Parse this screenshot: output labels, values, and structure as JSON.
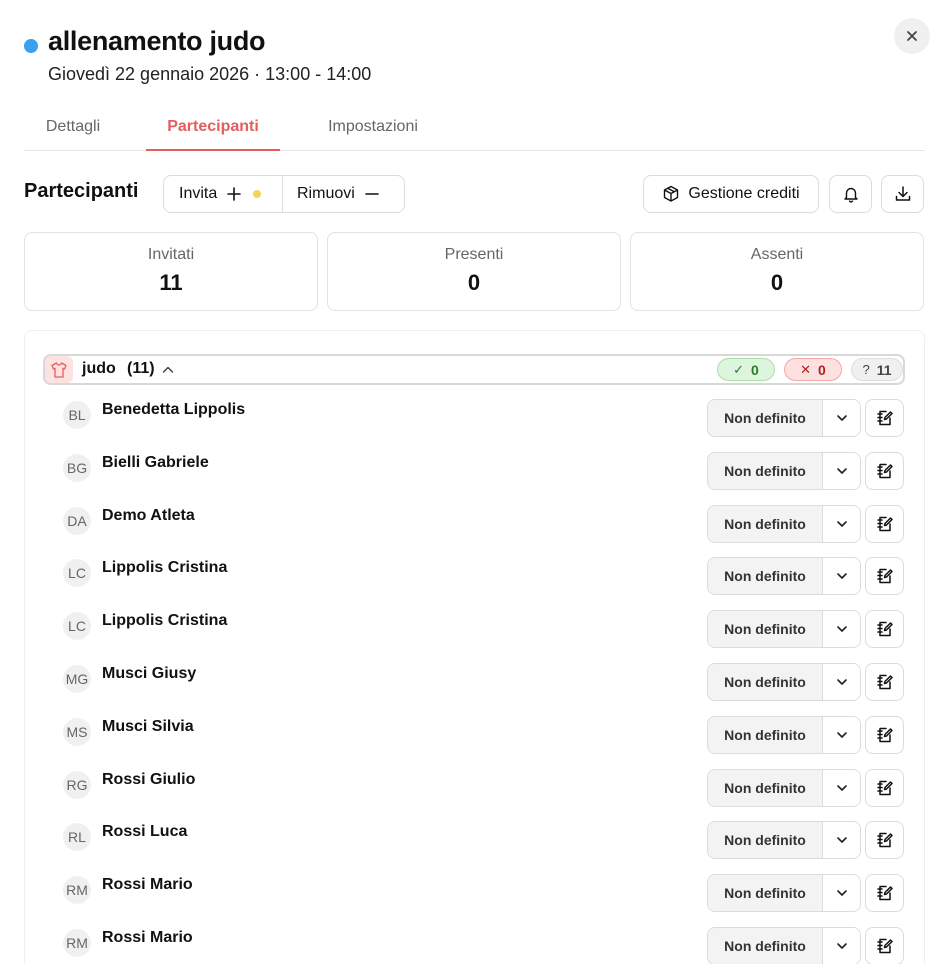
{
  "event": {
    "title": "allenamento judo",
    "subtitle": "Giovedì 22 gennaio 2026 · 13:00 - 14:00",
    "status_color": "#3aa0f0"
  },
  "tabs": [
    {
      "label": "Dettagli",
      "active": false
    },
    {
      "label": "Partecipanti",
      "active": true
    },
    {
      "label": "Impostazioni",
      "active": false
    }
  ],
  "toolbar": {
    "section_title": "Partecipanti",
    "invite_label": "Invita",
    "remove_label": "Rimuovi",
    "credits_label": "Gestione crediti",
    "icons": [
      "plus-icon",
      "minus-icon",
      "package-icon",
      "bell-icon",
      "download-icon"
    ]
  },
  "stats": [
    {
      "label": "Invitati",
      "value": "11"
    },
    {
      "label": "Presenti",
      "value": "0"
    },
    {
      "label": "Assenti",
      "value": "0"
    }
  ],
  "group": {
    "name": "judo",
    "count": "(11)",
    "present_symbol": "✓",
    "present_count": "0",
    "absent_symbol": "✕",
    "absent_count": "0",
    "unknown_symbol": "?",
    "unknown_count": "11"
  },
  "participants": [
    {
      "initials": "BL",
      "name": "Benedetta Lippolis",
      "status": "Non definito"
    },
    {
      "initials": "BG",
      "name": "Bielli Gabriele",
      "status": "Non definito"
    },
    {
      "initials": "DA",
      "name": "Demo Atleta",
      "status": "Non definito"
    },
    {
      "initials": "LC",
      "name": "Lippolis Cristina",
      "status": "Non definito"
    },
    {
      "initials": "LC",
      "name": "Lippolis Cristina",
      "status": "Non definito"
    },
    {
      "initials": "MG",
      "name": "Musci Giusy",
      "status": "Non definito"
    },
    {
      "initials": "MS",
      "name": "Musci Silvia",
      "status": "Non definito"
    },
    {
      "initials": "RG",
      "name": "Rossi Giulio",
      "status": "Non definito"
    },
    {
      "initials": "RL",
      "name": "Rossi Luca",
      "status": "Non definito"
    },
    {
      "initials": "RM",
      "name": "Rossi Mario",
      "status": "Non definito"
    },
    {
      "initials": "RM",
      "name": "Rossi Mario",
      "status": "Non definito"
    }
  ],
  "colors": {
    "accent": "#e55e5e",
    "status_dot": "#3aa0f0",
    "invite_dot": "#f4d45a",
    "present": "#2a7a2a",
    "absent": "#b02020"
  }
}
